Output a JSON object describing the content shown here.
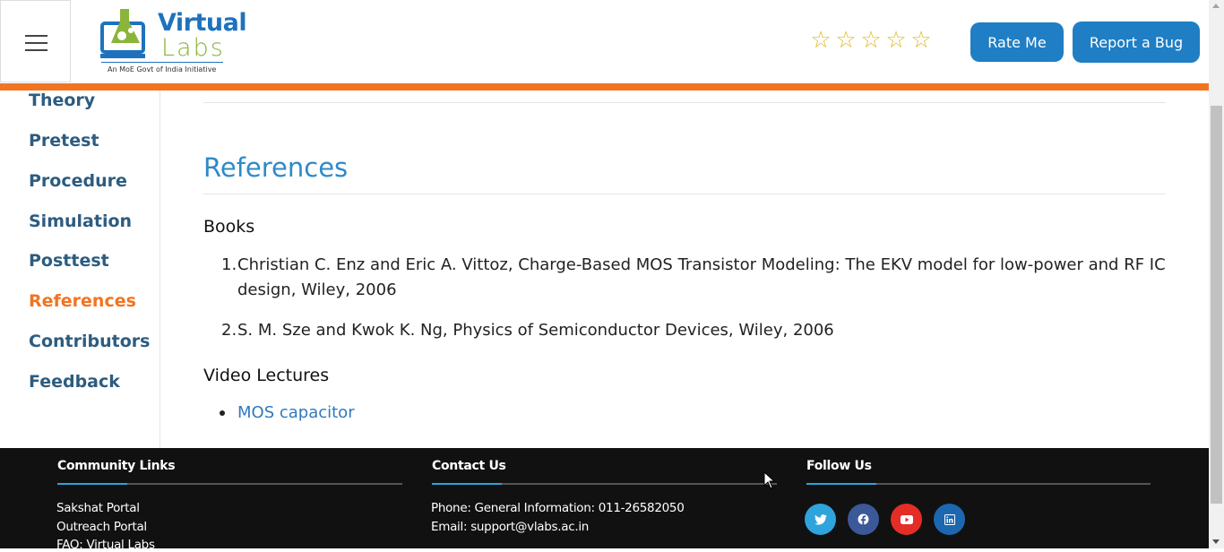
{
  "header": {
    "logo": {
      "line1": "Virtual",
      "line2": "Labs",
      "tagline": "An MoE Govt of India Initiative"
    },
    "rate_label": "Rate Me",
    "bug_label": "Report a Bug",
    "stars": [
      "☆",
      "☆",
      "☆",
      "☆",
      "☆"
    ]
  },
  "sidebar": {
    "items": [
      {
        "label": "Theory"
      },
      {
        "label": "Pretest"
      },
      {
        "label": "Procedure"
      },
      {
        "label": "Simulation"
      },
      {
        "label": "Posttest"
      },
      {
        "label": "References"
      },
      {
        "label": "Contributors"
      },
      {
        "label": "Feedback"
      }
    ],
    "active": "References"
  },
  "main": {
    "heading": "References",
    "books_heading": "Books",
    "books": [
      {
        "num": "1.",
        "text": "Christian C. Enz and Eric A. Vittoz, Charge-Based MOS Transistor Modeling: The EKV model for low-power and RF IC design, Wiley, 2006"
      },
      {
        "num": "2.",
        "text": "S. M. Sze and Kwok K. Ng, Physics of Semiconductor Devices, Wiley, 2006"
      }
    ],
    "video_heading": "Video Lectures",
    "videos": [
      {
        "label": "MOS capacitor"
      }
    ]
  },
  "footer": {
    "community": {
      "title": "Community Links",
      "links": [
        "Sakshat Portal",
        "Outreach Portal",
        "FAQ: Virtual Labs"
      ]
    },
    "contact": {
      "title": "Contact Us",
      "phone": "Phone: General Information: 011-26582050",
      "email": "Email: support@vlabs.ac.in"
    },
    "follow": {
      "title": "Follow Us",
      "icons": [
        "twitter-icon",
        "facebook-icon",
        "youtube-icon",
        "linkedin-icon"
      ]
    }
  },
  "colors": {
    "accent": "#f27421",
    "primary": "#1f7ec4",
    "heading": "#2e8ac9",
    "nav": "#2d5c80",
    "footer": "#111111"
  }
}
